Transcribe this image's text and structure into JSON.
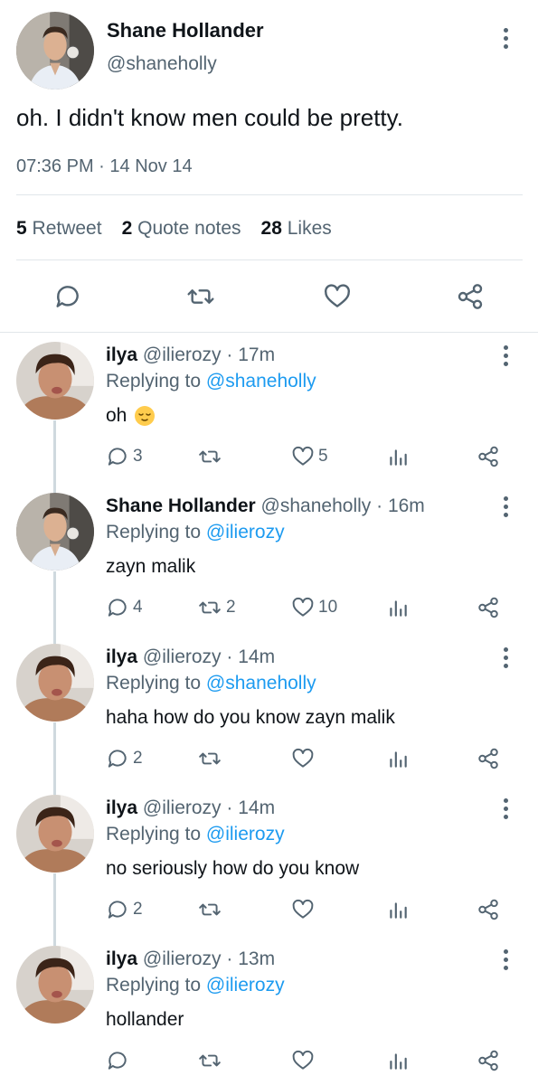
{
  "main_tweet": {
    "display_name": "Shane Hollander",
    "handle": "@shaneholly",
    "text": "oh. I didn't know men could be pretty.",
    "time": "07:36 PM",
    "separator": "·",
    "date": "14 Nov 14",
    "stats": [
      {
        "count": "5",
        "label": "Retweet"
      },
      {
        "count": "2",
        "label": "Quote notes"
      },
      {
        "count": "28",
        "label": "Likes"
      }
    ]
  },
  "replies": [
    {
      "name": "ilya",
      "handle": "@ilierozy",
      "time": "· 17m",
      "replying_prefix": "Replying to",
      "replying_to": "@shaneholly",
      "text": "oh",
      "emoji": "relieved-face",
      "reply_count": "3",
      "retweet_count": "",
      "like_count": "5"
    },
    {
      "name": "Shane Hollander",
      "handle": "@shaneholly",
      "time": "· 16m",
      "replying_prefix": "Replying to",
      "replying_to": "@ilierozy",
      "text": "zayn malik",
      "reply_count": "4",
      "retweet_count": "2",
      "like_count": "10"
    },
    {
      "name": "ilya",
      "handle": "@ilierozy",
      "time": "· 14m",
      "replying_prefix": "Replying to",
      "replying_to": "@shaneholly",
      "text": "haha how do you know zayn malik",
      "reply_count": "2",
      "retweet_count": "",
      "like_count": ""
    },
    {
      "name": "ilya",
      "handle": "@ilierozy",
      "time": "· 14m",
      "replying_prefix": "Replying to",
      "replying_to": "@ilierozy",
      "text": "no seriously how do you know",
      "reply_count": "2",
      "retweet_count": "",
      "like_count": ""
    },
    {
      "name": "ilya",
      "handle": "@ilierozy",
      "time": "· 13m",
      "replying_prefix": "Replying to",
      "replying_to": "@ilierozy",
      "text": "hollander",
      "reply_count": "",
      "retweet_count": "",
      "like_count": ""
    }
  ],
  "colors": {
    "text": "#0f1419",
    "secondary": "#536471",
    "link": "#1d9bf0",
    "divider": "#e1e6ea"
  }
}
